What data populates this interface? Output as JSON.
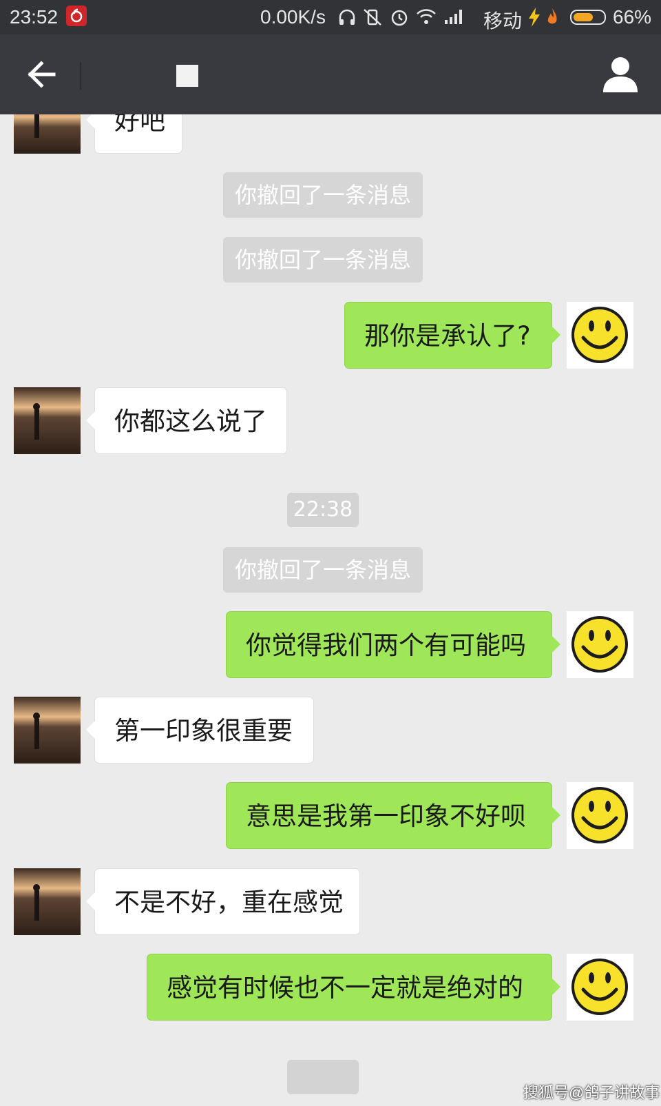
{
  "status_bar": {
    "time": "23:52",
    "network_speed": "0.00K/s",
    "carrier": "移动",
    "battery_percent": "66%",
    "battery_level": 0.66
  },
  "header": {
    "title": ""
  },
  "messages": {
    "m0": "好吧",
    "sys1": "你撤回了一条消息",
    "sys2": "你撤回了一条消息",
    "m1": "那你是承认了?",
    "m2": "你都这么说了",
    "time1": "22:38",
    "sys3": "你撤回了一条消息",
    "m3": "你觉得我们两个有可能吗",
    "m4": "第一印象很重要",
    "m5": "意思是我第一印象不好呗",
    "m6": "不是不好，重在感觉",
    "m7": "感觉有时候也不一定就是绝对的"
  },
  "watermark": "搜狐号@鸽子讲故事",
  "colors": {
    "outgoing_bubble": "#9fe658",
    "incoming_bubble": "#ffffff",
    "header_bg": "#393a3f",
    "chat_bg": "#ebebeb"
  }
}
